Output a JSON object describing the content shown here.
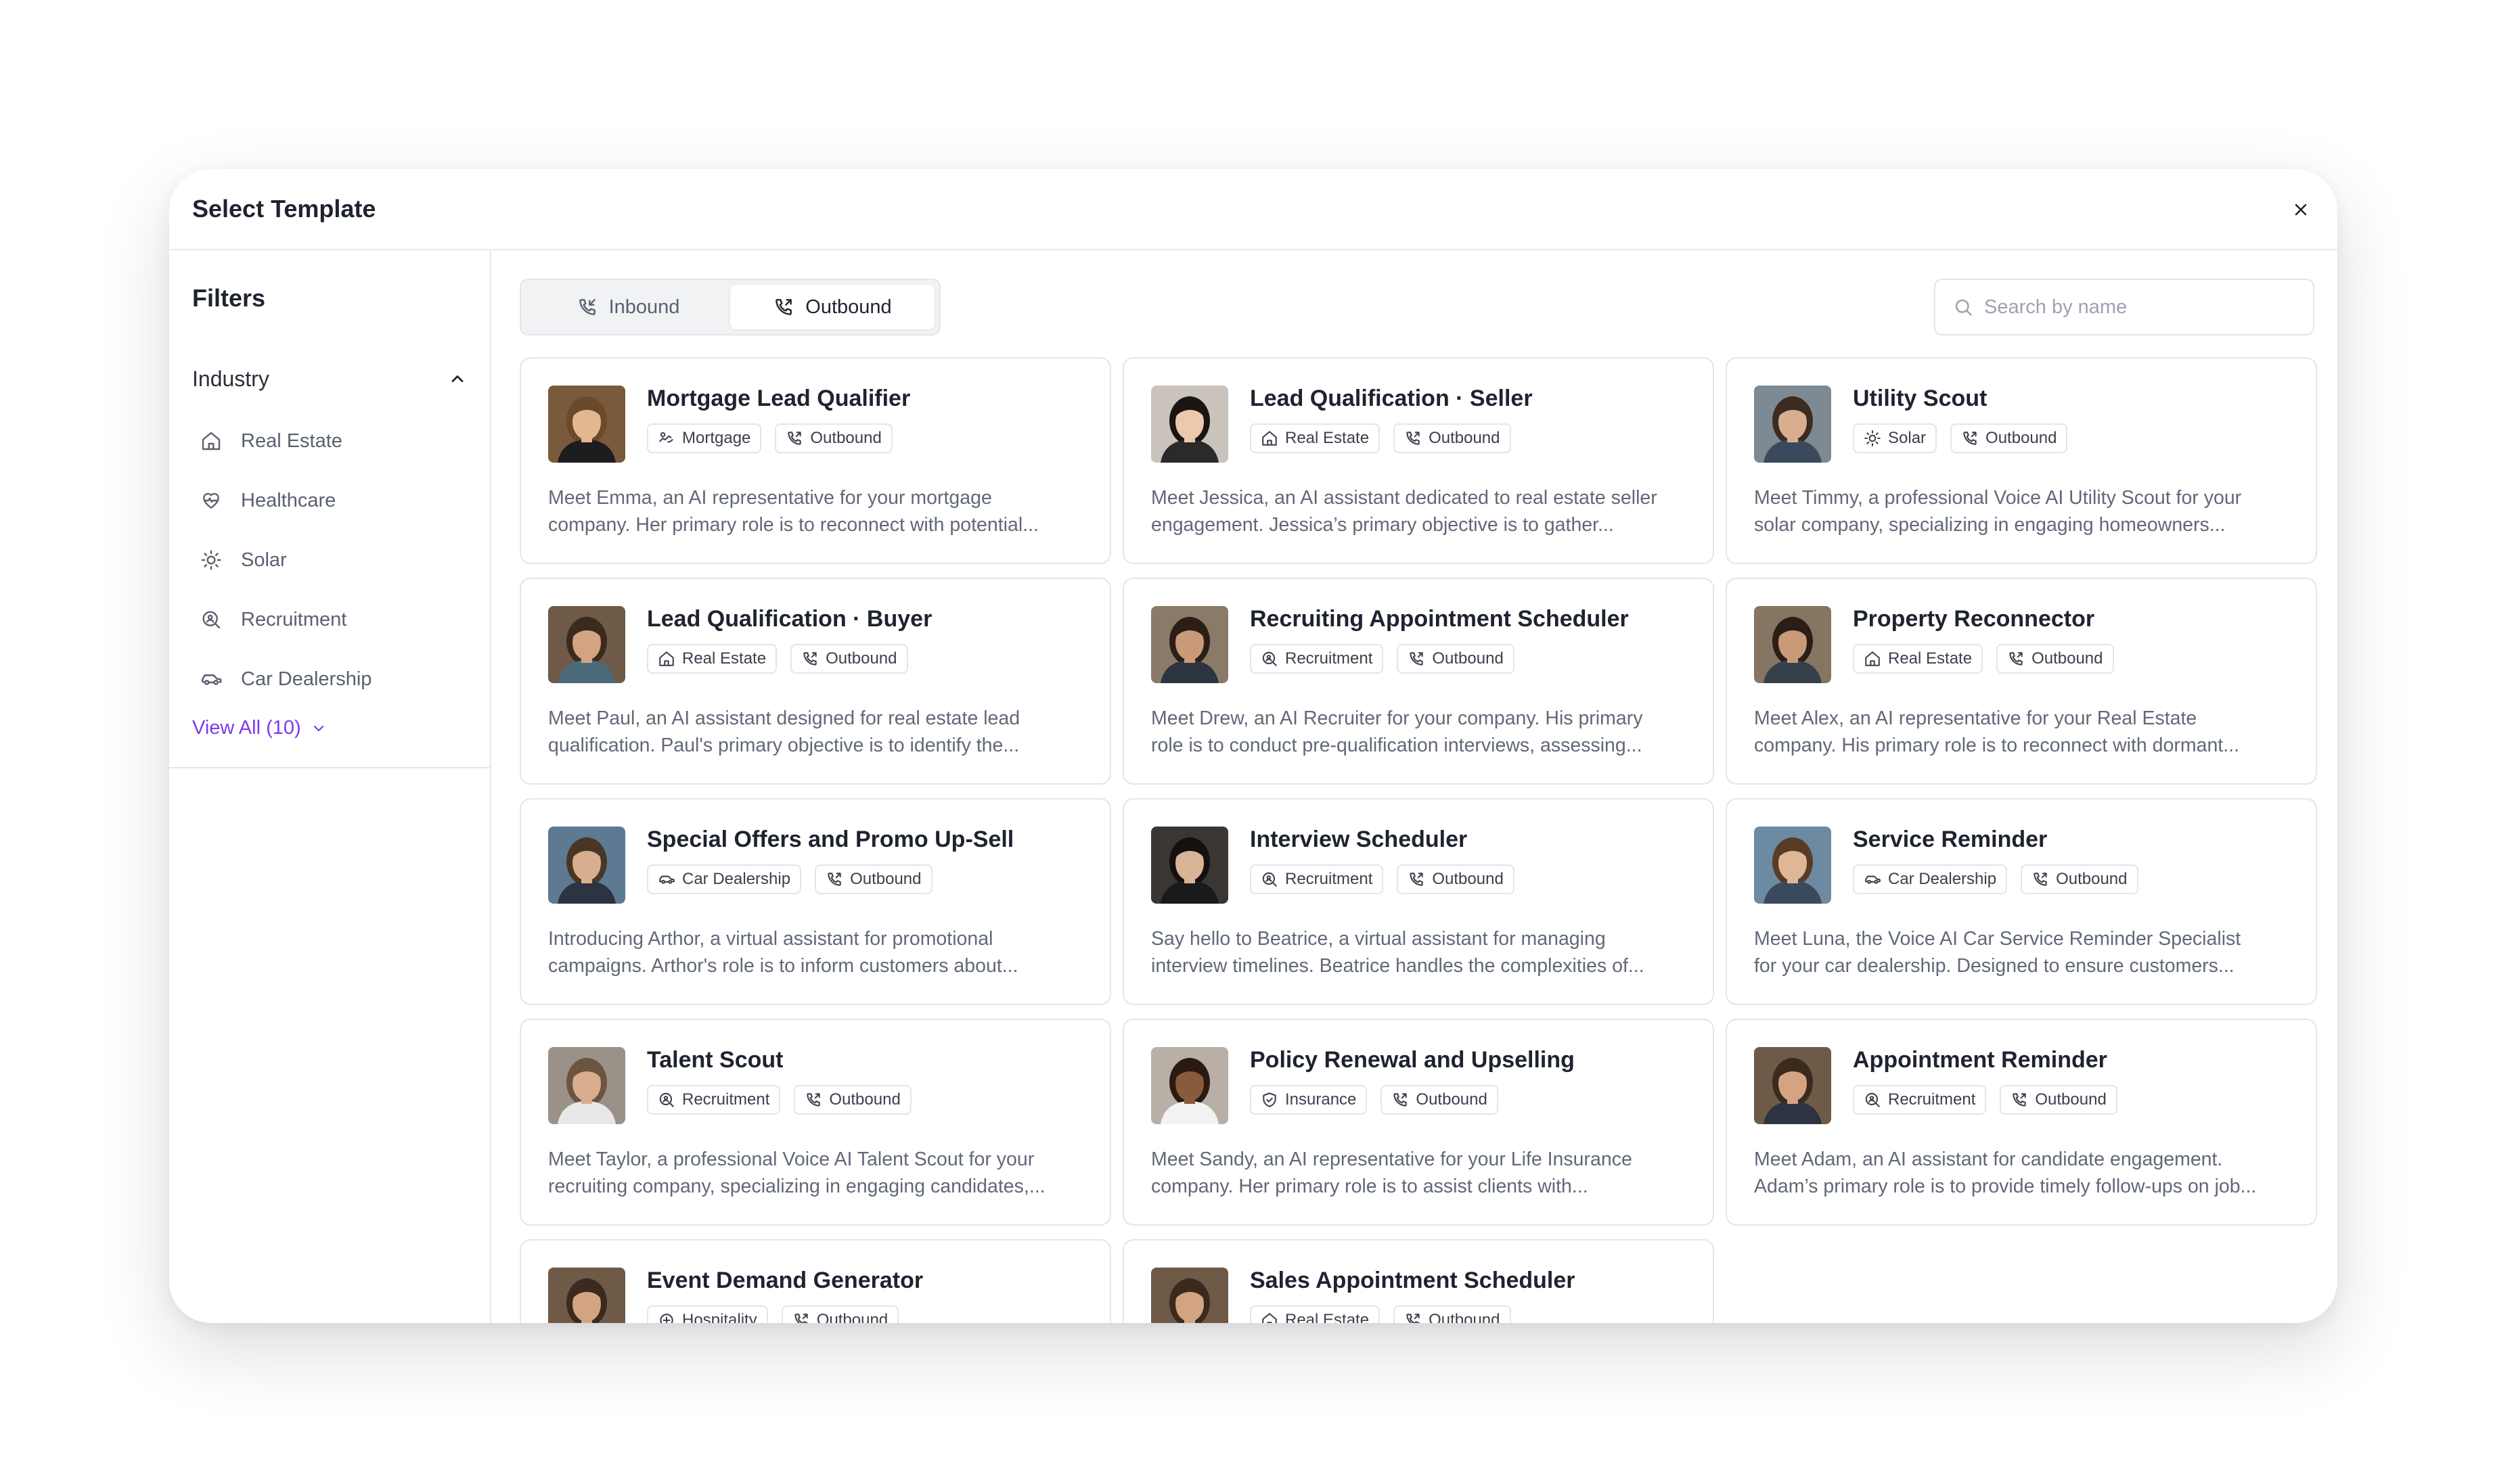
{
  "modal": {
    "title": "Select Template"
  },
  "sidebar": {
    "title": "Filters",
    "industry_label": "Industry",
    "items": [
      {
        "label": "Real Estate",
        "icon": "home-icon"
      },
      {
        "label": "Healthcare",
        "icon": "heart-pulse-icon"
      },
      {
        "label": "Solar",
        "icon": "sun-icon"
      },
      {
        "label": "Recruitment",
        "icon": "search-person-icon"
      },
      {
        "label": "Car Dealership",
        "icon": "car-icon"
      }
    ],
    "view_all": "View All (10)"
  },
  "tabs": [
    {
      "label": "Inbound",
      "active": false
    },
    {
      "label": "Outbound",
      "active": true
    }
  ],
  "search": {
    "placeholder": "Search by name"
  },
  "cards": [
    {
      "title": "Mortgage Lead Qualifier",
      "industry": "Mortgage",
      "direction": "Outbound",
      "desc1": "Meet Emma, an AI representative for your mortgage",
      "desc2": "company. Her primary role is to reconnect with potential...",
      "avatar_bg": "#7a5a3c",
      "skin": "#e2b792",
      "hair": "#6b4a2a",
      "shirt": "#1d1d1d"
    },
    {
      "title": "Lead Qualification · Seller",
      "industry": "Real Estate",
      "direction": "Outbound",
      "desc1": "Meet Jessica, an AI assistant dedicated to real estate seller",
      "desc2": "engagement. Jessica’s primary objective is to gather...",
      "avatar_bg": "#c9c3bb",
      "skin": "#ecc8ad",
      "hair": "#1b1512",
      "shirt": "#2a2a2a"
    },
    {
      "title": "Utility Scout",
      "industry": "Solar",
      "direction": "Outbound",
      "desc1": "Meet Timmy, a professional Voice AI Utility Scout for your",
      "desc2": "solar company, specializing in engaging homeowners...",
      "avatar_bg": "#7d8a93",
      "skin": "#d8ae8e",
      "hair": "#3b2c22",
      "shirt": "#3a4a5c"
    },
    {
      "title": "Lead Qualification · Buyer",
      "industry": "Real Estate",
      "direction": "Outbound",
      "desc1": "Meet Paul, an AI assistant designed for real estate lead",
      "desc2": "qualification. Paul's primary objective is to identify the...",
      "avatar_bg": "#6e5a46",
      "skin": "#d4a482",
      "hair": "#3b2a1e",
      "shirt": "#4a6a7a"
    },
    {
      "title": "Recruiting Appointment Scheduler",
      "industry": "Recruitment",
      "direction": "Outbound",
      "desc1": "Meet Drew, an AI Recruiter for your company. His primary",
      "desc2": "role is to conduct pre-qualification interviews, assessing...",
      "avatar_bg": "#8a7a68",
      "skin": "#c99a78",
      "hair": "#2b1e16",
      "shirt": "#2b3440"
    },
    {
      "title": "Property Reconnector",
      "industry": "Real Estate",
      "direction": "Outbound",
      "desc1": "Meet Alex, an AI representative for your Real Estate",
      "desc2": "company. His primary role is to reconnect with dormant...",
      "avatar_bg": "#857561",
      "skin": "#c99a78",
      "hair": "#2b1e16",
      "shirt": "#35404c"
    },
    {
      "title": "Special Offers and Promo Up-Sell",
      "industry": "Car Dealership",
      "direction": "Outbound",
      "desc1": "Introducing Arthor, a virtual assistant for promotional",
      "desc2": "campaigns. Arthor's role is to inform customers about...",
      "avatar_bg": "#5d7a92",
      "skin": "#d8ae8e",
      "hair": "#4a3626",
      "shirt": "#2b3440"
    },
    {
      "title": "Interview Scheduler",
      "industry": "Recruitment",
      "direction": "Outbound",
      "desc1": "Say hello to Beatrice, a virtual assistant for managing",
      "desc2": "interview timelines. Beatrice handles the complexities of...",
      "avatar_bg": "#3a3633",
      "skin": "#d9b396",
      "hair": "#141010",
      "shirt": "#1a1a1a"
    },
    {
      "title": "Service Reminder",
      "industry": "Car Dealership",
      "direction": "Outbound",
      "desc1": "Meet Luna, the Voice AI Car Service Reminder Specialist",
      "desc2": "for your car dealership. Designed to ensure customers...",
      "avatar_bg": "#6c8aa2",
      "skin": "#e0b796",
      "hair": "#5a3b26",
      "shirt": "#3a4a5c"
    },
    {
      "title": "Talent Scout",
      "industry": "Recruitment",
      "direction": "Outbound",
      "desc1": "Meet Taylor, a professional Voice AI Talent Scout for your",
      "desc2": "recruiting company, specializing in engaging candidates,...",
      "avatar_bg": "#9a9288",
      "skin": "#d8ae8e",
      "hair": "#6b5440",
      "shirt": "#e8e8e8"
    },
    {
      "title": "Policy Renewal and Upselling",
      "industry": "Insurance",
      "direction": "Outbound",
      "desc1": "Meet Sandy, an AI representative for your Life Insurance",
      "desc2": "company. Her primary role is to assist clients with...",
      "avatar_bg": "#b8b0a6",
      "skin": "#8a5a3c",
      "hair": "#2a1a12",
      "shirt": "#f2f2f2"
    },
    {
      "title": "Appointment Reminder",
      "industry": "Recruitment",
      "direction": "Outbound",
      "desc1": "Meet Adam, an AI assistant for candidate engagement.",
      "desc2": "Adam’s primary role is to provide timely follow-ups on job...",
      "avatar_bg": "#6e5a46",
      "skin": "#d4a482",
      "hair": "#3b2a1e",
      "shirt": "#2b3440"
    },
    {
      "title": "Event Demand Generator",
      "industry": "Hospitality",
      "direction": "Outbound",
      "desc1": "",
      "desc2": "",
      "avatar_bg": "#6e5a46",
      "skin": "#d4a482",
      "hair": "#3b2a1e",
      "shirt": "#2b3440"
    },
    {
      "title": "Sales Appointment Scheduler",
      "industry": "Real Estate",
      "direction": "Outbound",
      "desc1": "",
      "desc2": "",
      "avatar_bg": "#6e5a46",
      "skin": "#d4a482",
      "hair": "#3b2a1e",
      "shirt": "#2b3440"
    }
  ],
  "colors": {
    "accent": "#7c3aed",
    "border": "#e3e5ea",
    "text": "#1f2330",
    "muted": "#616878"
  }
}
